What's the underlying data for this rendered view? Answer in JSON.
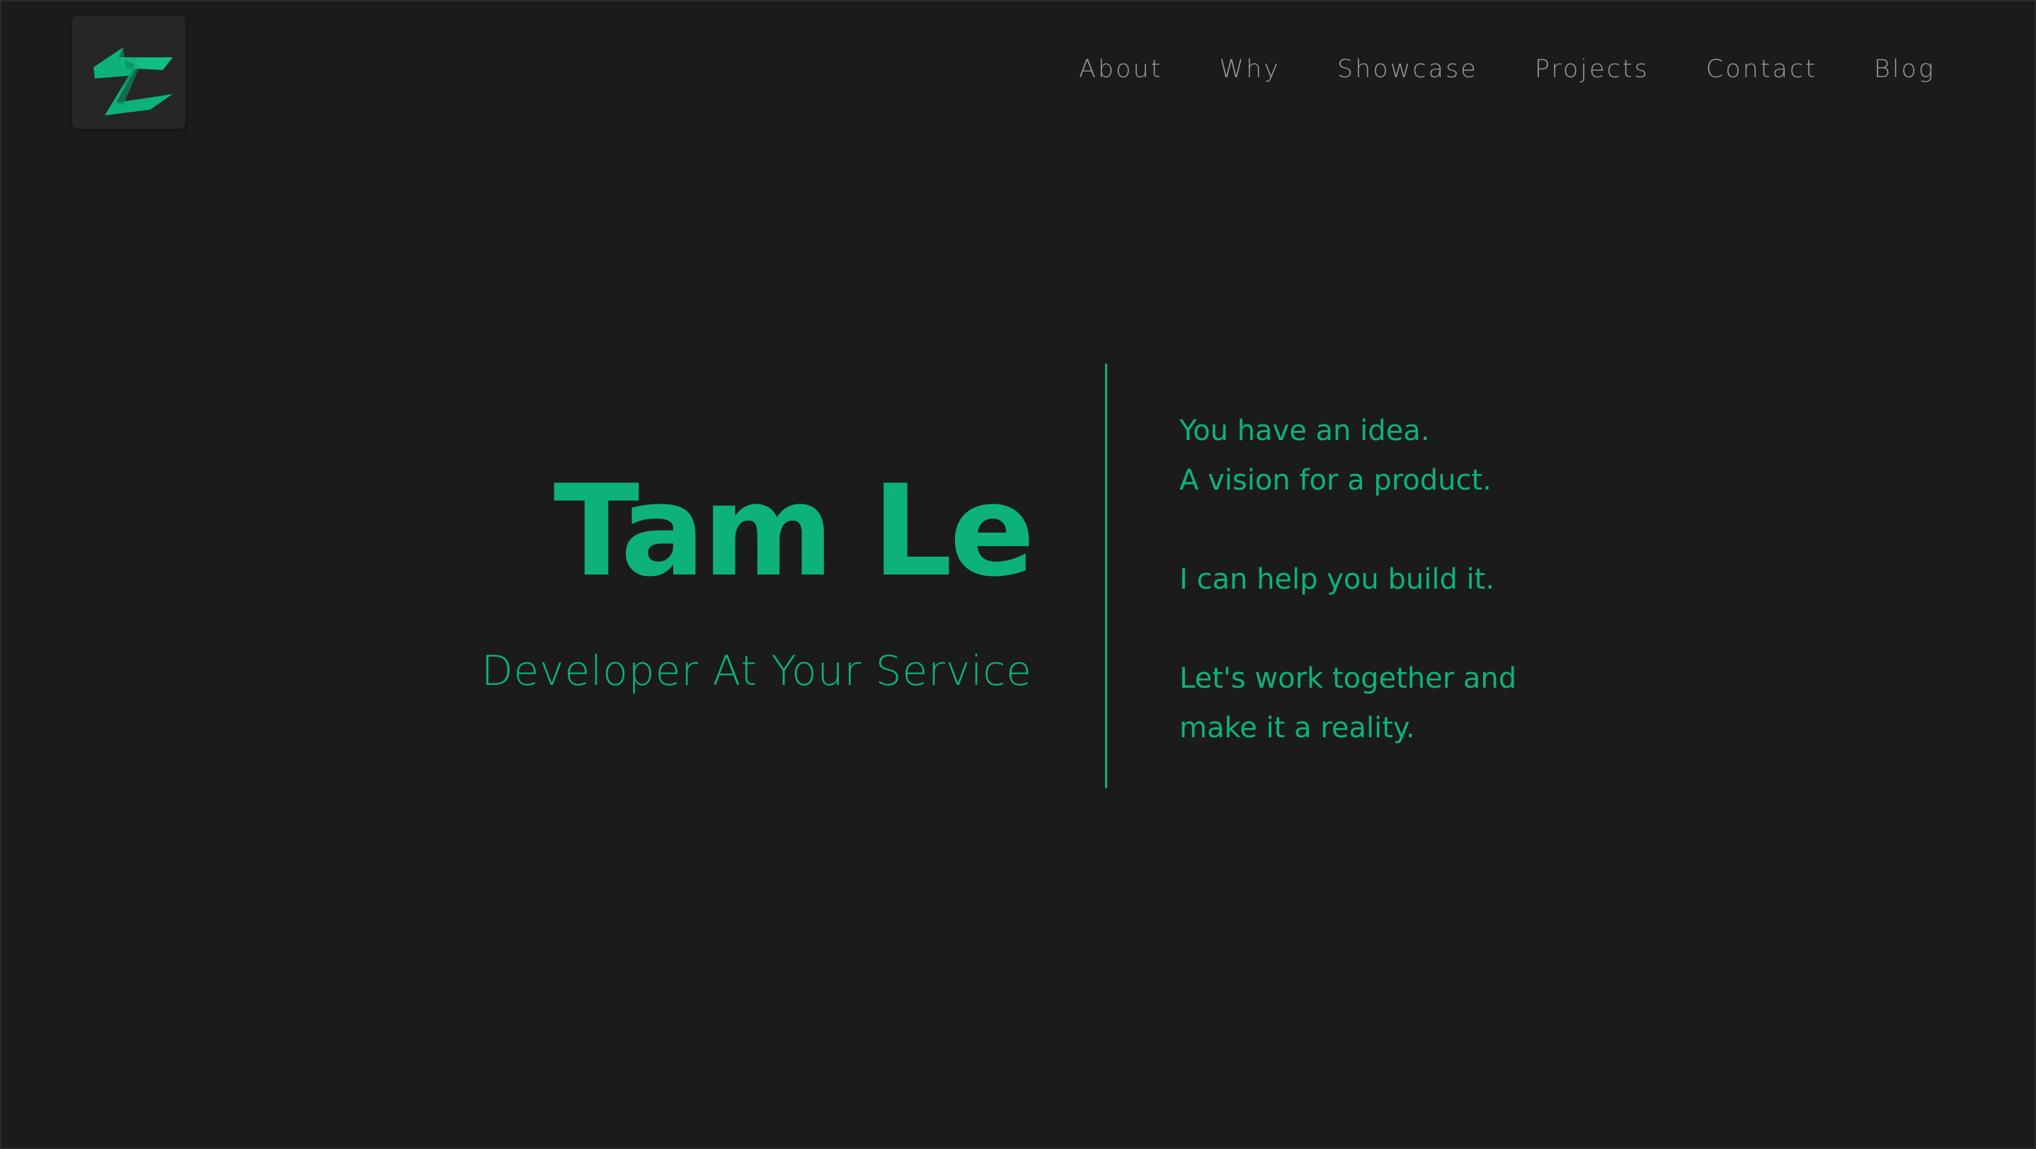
{
  "logo": {
    "icon": "lightning-t-logo",
    "background": "#262626",
    "accent": "#0db27a"
  },
  "nav": {
    "items": [
      {
        "label": "About"
      },
      {
        "label": "Why"
      },
      {
        "label": "Showcase"
      },
      {
        "label": "Projects"
      },
      {
        "label": "Contact"
      },
      {
        "label": "Blog"
      }
    ]
  },
  "hero": {
    "name": "Tam Le",
    "tagline": "Developer At Your Service",
    "lines": [
      [
        "You have an idea.",
        "A vision for a product."
      ],
      [
        "I can help you build it."
      ],
      [
        "Let's work together and",
        "make it a reality."
      ]
    ]
  },
  "colors": {
    "background": "#1b1b1b",
    "accent": "#0db27a",
    "nav_text": "#9a9a9a"
  }
}
